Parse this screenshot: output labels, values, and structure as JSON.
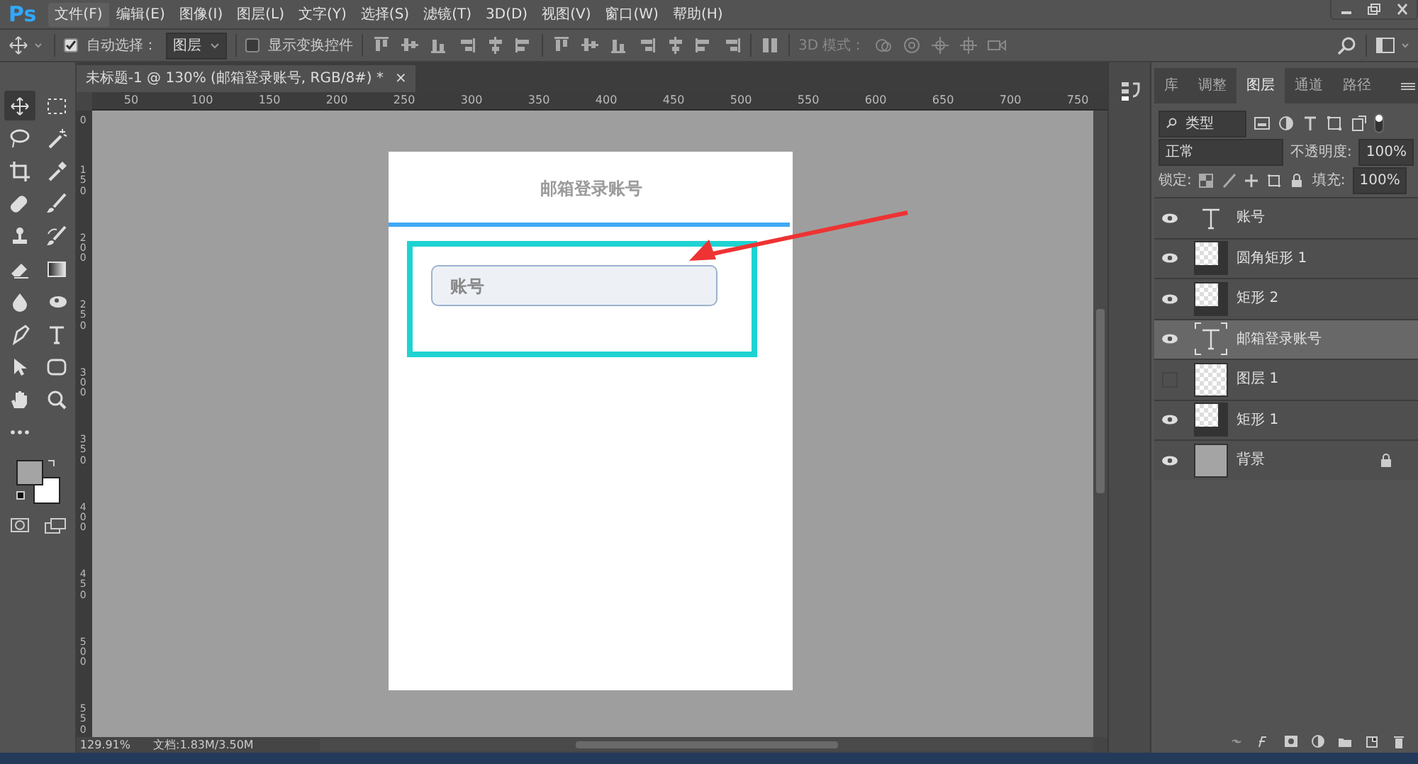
{
  "app_logo": "Ps",
  "menu": [
    {
      "label": "文件(F)",
      "selected": true
    },
    {
      "label": "编辑(E)",
      "selected": false
    },
    {
      "label": "图像(I)",
      "selected": false
    },
    {
      "label": "图层(L)",
      "selected": false
    },
    {
      "label": "文字(Y)",
      "selected": false
    },
    {
      "label": "选择(S)",
      "selected": false
    },
    {
      "label": "滤镜(T)",
      "selected": false
    },
    {
      "label": "3D(D)",
      "selected": false
    },
    {
      "label": "视图(V)",
      "selected": false
    },
    {
      "label": "窗口(W)",
      "selected": false
    },
    {
      "label": "帮助(H)",
      "selected": false
    }
  ],
  "options_bar": {
    "auto_select": {
      "label": "自动选择：",
      "checked": true
    },
    "auto_select_target": "图层",
    "transform_controls": {
      "label": "显示变换控件",
      "checked": false
    },
    "mode_3d_label": "3D 模式："
  },
  "tools": [
    {
      "kind": "move",
      "selected": true
    },
    {
      "kind": "marquee",
      "selected": false
    },
    {
      "kind": "lasso",
      "selected": false
    },
    {
      "kind": "wand",
      "selected": false
    },
    {
      "kind": "crop",
      "selected": false
    },
    {
      "kind": "eyedropper",
      "selected": false
    },
    {
      "kind": "heal",
      "selected": false
    },
    {
      "kind": "brush",
      "selected": false
    },
    {
      "kind": "stamp",
      "selected": false
    },
    {
      "kind": "history",
      "selected": false
    },
    {
      "kind": "eraser",
      "selected": false
    },
    {
      "kind": "gradient",
      "selected": false
    },
    {
      "kind": "drop",
      "selected": false
    },
    {
      "kind": "dodge",
      "selected": false
    },
    {
      "kind": "pen",
      "selected": false
    },
    {
      "kind": "type",
      "selected": false
    },
    {
      "kind": "select",
      "selected": false
    },
    {
      "kind": "shape",
      "selected": false
    },
    {
      "kind": "hand",
      "selected": false
    },
    {
      "kind": "zoom",
      "selected": false
    },
    {
      "kind": "more",
      "selected": false
    }
  ],
  "document_tab": {
    "title": "未标题-1 @ 130% (邮箱登录账号, RGB/8#) *",
    "close": "×"
  },
  "ruler_h": [
    "50",
    "100",
    "150",
    "200",
    "250",
    "300",
    "350",
    "400",
    "450",
    "500",
    "550",
    "600",
    "650",
    "700",
    "750"
  ],
  "ruler_v": [
    "0",
    "150",
    "200",
    "250",
    "300",
    "350",
    "400",
    "450",
    "500",
    "550"
  ],
  "canvas": {
    "heading": "邮箱登录账号",
    "field_text": "账号"
  },
  "panel_tabs": [
    {
      "label": "库",
      "selected": false
    },
    {
      "label": "调整",
      "selected": false
    },
    {
      "label": "图层",
      "selected": true
    },
    {
      "label": "通道",
      "selected": false
    },
    {
      "label": "路径",
      "selected": false
    }
  ],
  "layers_panel": {
    "filter": "类型",
    "blend_mode": "正常",
    "opacity_label": "不透明度:",
    "opacity": "100%",
    "lock_label": "锁定:",
    "fill_label": "填充:",
    "fill": "100%"
  },
  "layers": [
    {
      "name": "账号",
      "kind": "text",
      "visible": true,
      "selected": false
    },
    {
      "name": "圆角矩形 1",
      "kind": "shape",
      "visible": true,
      "selected": false
    },
    {
      "name": "矩形 2",
      "kind": "shape",
      "visible": true,
      "selected": false
    },
    {
      "name": "邮箱登录账号",
      "kind": "text",
      "visible": true,
      "selected": true
    },
    {
      "name": "图层 1",
      "kind": "raster",
      "visible": false,
      "selected": false
    },
    {
      "name": "矩形 1",
      "kind": "shape",
      "visible": true,
      "selected": false
    },
    {
      "name": "背景",
      "kind": "background",
      "visible": true,
      "selected": false
    }
  ],
  "status_bar": {
    "zoom": "129.91%",
    "doc_size": "文档:1.83M/3.50M"
  }
}
